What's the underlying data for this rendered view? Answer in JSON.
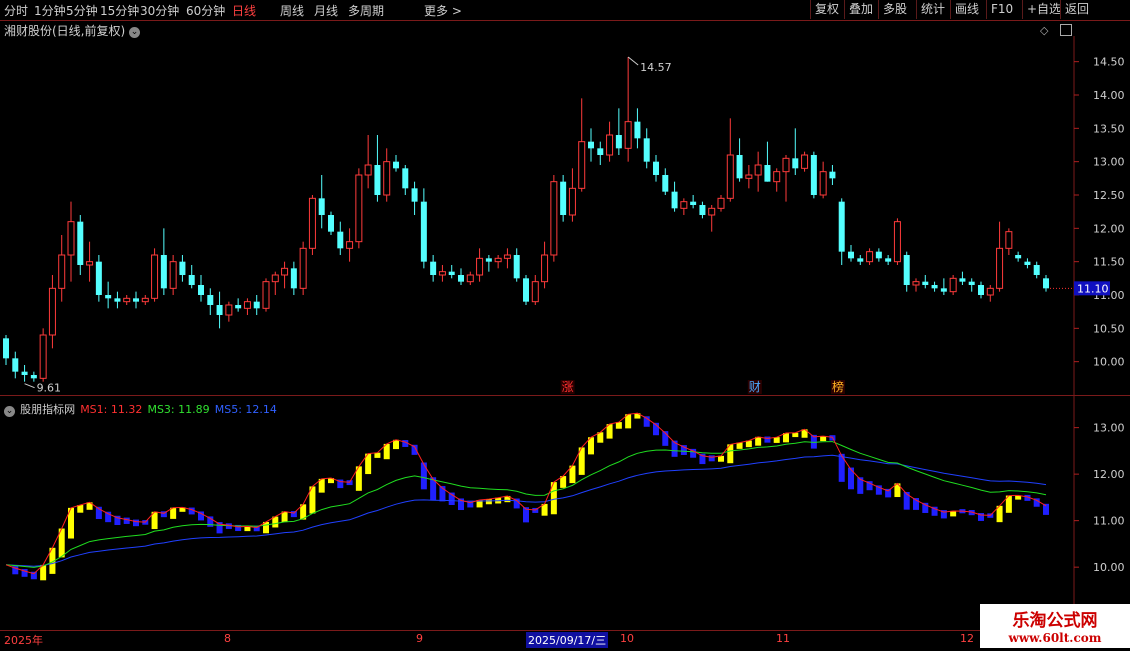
{
  "toolbar": {
    "periods": [
      "分时",
      "1分钟",
      "5分钟",
      "15分钟",
      "30分钟",
      "60分钟",
      "日线",
      "周线",
      "月线",
      "多周期",
      "更多 >"
    ],
    "active_period": "日线",
    "right_buttons": [
      "复权",
      "叠加",
      "多股",
      "统计",
      "画线",
      "F10",
      "+自选",
      "返回"
    ]
  },
  "main_chart": {
    "title": "湘财股份(日线,前复权)",
    "y_ticks": [
      "14.50",
      "14.00",
      "13.50",
      "13.00",
      "12.50",
      "12.00",
      "11.50",
      "11.00",
      "10.50",
      "10.00"
    ],
    "high_label": "14.57",
    "low_label": "9.61",
    "current_price": "11.10",
    "markers": [
      {
        "text": "涨",
        "color": "#ff3030"
      },
      {
        "text": "财",
        "color": "#4aa8ff"
      },
      {
        "text": "榜",
        "color": "#ffb020"
      }
    ]
  },
  "indicator": {
    "name": "股朋指标网",
    "ms1": "MS1: 11.32",
    "ms3": "MS3: 11.89",
    "ms5": "MS5: 12.14",
    "y_ticks": [
      "13.00",
      "12.00",
      "11.00",
      "10.00",
      "9.00"
    ]
  },
  "x_axis": {
    "labels": [
      "2025年",
      "8",
      "9",
      "2025/09/17/三",
      "10",
      "11",
      "12"
    ]
  },
  "watermark": {
    "line1": "乐淘公式网",
    "line2": "www.60lt.com"
  },
  "colors": {
    "up": "#ff3b3b",
    "down": "#54ffff",
    "ms1": "#ff2020",
    "ms3": "#20dd20",
    "ms5": "#2040ff",
    "bar_up": "#ffff00",
    "bar_down": "#2020ff"
  },
  "chart_data": {
    "type": "candlestick",
    "ohlc": [
      [
        10.35,
        10.4,
        9.95,
        10.05
      ],
      [
        10.05,
        10.15,
        9.75,
        9.85
      ],
      [
        9.85,
        9.95,
        9.7,
        9.8
      ],
      [
        9.8,
        9.85,
        9.7,
        9.75
      ],
      [
        9.75,
        10.5,
        9.7,
        10.4
      ],
      [
        10.4,
        11.3,
        10.2,
        11.1
      ],
      [
        11.1,
        11.9,
        10.9,
        11.6
      ],
      [
        11.6,
        12.4,
        11.2,
        12.1
      ],
      [
        12.1,
        12.2,
        11.3,
        11.45
      ],
      [
        11.45,
        11.8,
        11.2,
        11.5
      ],
      [
        11.5,
        11.6,
        10.9,
        11.0
      ],
      [
        11.0,
        11.2,
        10.8,
        10.95
      ],
      [
        10.95,
        11.05,
        10.8,
        10.9
      ],
      [
        10.9,
        11.0,
        10.85,
        10.95
      ],
      [
        10.95,
        11.05,
        10.8,
        10.9
      ],
      [
        10.9,
        11.0,
        10.85,
        10.95
      ],
      [
        10.95,
        11.7,
        10.9,
        11.6
      ],
      [
        11.6,
        12.0,
        11.0,
        11.1
      ],
      [
        11.1,
        11.6,
        11.0,
        11.5
      ],
      [
        11.5,
        11.6,
        11.2,
        11.3
      ],
      [
        11.3,
        11.45,
        11.1,
        11.15
      ],
      [
        11.15,
        11.3,
        10.9,
        11.0
      ],
      [
        11.0,
        11.1,
        10.7,
        10.85
      ],
      [
        10.85,
        11.05,
        10.5,
        10.7
      ],
      [
        10.7,
        10.9,
        10.6,
        10.85
      ],
      [
        10.85,
        10.95,
        10.75,
        10.8
      ],
      [
        10.8,
        10.95,
        10.7,
        10.9
      ],
      [
        10.9,
        11.0,
        10.7,
        10.8
      ],
      [
        10.8,
        11.25,
        10.75,
        11.2
      ],
      [
        11.2,
        11.35,
        11.0,
        11.3
      ],
      [
        11.3,
        11.5,
        11.1,
        11.4
      ],
      [
        11.4,
        11.5,
        11.0,
        11.1
      ],
      [
        11.1,
        11.8,
        11.0,
        11.7
      ],
      [
        11.7,
        12.5,
        11.6,
        12.45
      ],
      [
        12.45,
        12.8,
        12.0,
        12.2
      ],
      [
        12.2,
        12.25,
        11.9,
        11.95
      ],
      [
        11.95,
        12.1,
        11.6,
        11.7
      ],
      [
        11.7,
        12.0,
        11.5,
        11.8
      ],
      [
        11.8,
        12.9,
        11.7,
        12.8
      ],
      [
        12.8,
        13.4,
        12.6,
        12.95
      ],
      [
        12.95,
        13.4,
        12.4,
        12.5
      ],
      [
        12.5,
        13.2,
        12.4,
        13.0
      ],
      [
        13.0,
        13.1,
        12.85,
        12.9
      ],
      [
        12.9,
        12.95,
        12.5,
        12.6
      ],
      [
        12.6,
        12.7,
        12.2,
        12.4
      ],
      [
        12.4,
        12.6,
        11.4,
        11.5
      ],
      [
        11.5,
        11.6,
        11.2,
        11.3
      ],
      [
        11.3,
        11.45,
        11.2,
        11.35
      ],
      [
        11.35,
        11.45,
        11.25,
        11.3
      ],
      [
        11.3,
        11.4,
        11.15,
        11.2
      ],
      [
        11.2,
        11.35,
        11.15,
        11.3
      ],
      [
        11.3,
        11.7,
        11.2,
        11.55
      ],
      [
        11.55,
        11.6,
        11.35,
        11.5
      ],
      [
        11.5,
        11.6,
        11.4,
        11.55
      ],
      [
        11.55,
        11.7,
        11.4,
        11.6
      ],
      [
        11.6,
        11.7,
        11.2,
        11.25
      ],
      [
        11.25,
        11.3,
        10.85,
        10.9
      ],
      [
        10.9,
        11.3,
        10.85,
        11.2
      ],
      [
        11.2,
        11.8,
        11.1,
        11.6
      ],
      [
        11.6,
        12.8,
        11.5,
        12.7
      ],
      [
        12.7,
        12.8,
        12.1,
        12.2
      ],
      [
        12.2,
        12.9,
        12.1,
        12.6
      ],
      [
        12.6,
        13.95,
        12.55,
        13.3
      ],
      [
        13.3,
        13.5,
        13.0,
        13.2
      ],
      [
        13.2,
        13.3,
        12.95,
        13.1
      ],
      [
        13.1,
        13.6,
        13.0,
        13.4
      ],
      [
        13.4,
        13.8,
        13.1,
        13.2
      ],
      [
        13.2,
        14.57,
        13.0,
        13.6
      ],
      [
        13.6,
        13.8,
        13.2,
        13.35
      ],
      [
        13.35,
        13.5,
        12.9,
        13.0
      ],
      [
        13.0,
        13.1,
        12.7,
        12.8
      ],
      [
        12.8,
        12.9,
        12.5,
        12.55
      ],
      [
        12.55,
        12.7,
        12.25,
        12.3
      ],
      [
        12.3,
        12.45,
        12.2,
        12.4
      ],
      [
        12.4,
        12.5,
        12.3,
        12.35
      ],
      [
        12.35,
        12.4,
        12.15,
        12.2
      ],
      [
        12.2,
        12.35,
        11.95,
        12.3
      ],
      [
        12.3,
        12.5,
        12.25,
        12.45
      ],
      [
        12.45,
        13.65,
        12.4,
        13.1
      ],
      [
        13.1,
        13.35,
        12.7,
        12.75
      ],
      [
        12.75,
        12.95,
        12.6,
        12.8
      ],
      [
        12.8,
        13.15,
        12.55,
        12.95
      ],
      [
        12.95,
        13.3,
        12.7,
        12.7
      ],
      [
        12.7,
        12.9,
        12.55,
        12.85
      ],
      [
        12.85,
        13.1,
        12.4,
        13.05
      ],
      [
        13.05,
        13.5,
        12.8,
        12.9
      ],
      [
        12.9,
        13.15,
        12.85,
        13.1
      ],
      [
        13.1,
        13.15,
        12.45,
        12.5
      ],
      [
        12.5,
        13.0,
        12.45,
        12.85
      ],
      [
        12.85,
        12.95,
        12.65,
        12.75
      ],
      [
        12.4,
        12.45,
        11.45,
        11.65
      ],
      [
        11.65,
        11.75,
        11.5,
        11.55
      ],
      [
        11.55,
        11.6,
        11.45,
        11.5
      ],
      [
        11.5,
        11.7,
        11.45,
        11.65
      ],
      [
        11.65,
        11.7,
        11.5,
        11.55
      ],
      [
        11.55,
        11.6,
        11.45,
        11.5
      ],
      [
        11.5,
        12.15,
        11.45,
        12.1
      ],
      [
        11.6,
        11.65,
        11.05,
        11.15
      ],
      [
        11.15,
        11.25,
        11.05,
        11.2
      ],
      [
        11.2,
        11.3,
        11.1,
        11.15
      ],
      [
        11.15,
        11.2,
        11.05,
        11.1
      ],
      [
        11.1,
        11.25,
        11.0,
        11.05
      ],
      [
        11.05,
        11.3,
        11.0,
        11.25
      ],
      [
        11.25,
        11.35,
        11.15,
        11.2
      ],
      [
        11.2,
        11.25,
        11.05,
        11.15
      ],
      [
        11.15,
        11.2,
        10.95,
        11.0
      ],
      [
        11.0,
        11.15,
        10.9,
        11.1
      ],
      [
        11.1,
        12.1,
        11.05,
        11.7
      ],
      [
        11.7,
        12.0,
        11.6,
        11.95
      ],
      [
        11.6,
        11.65,
        11.5,
        11.55
      ],
      [
        11.5,
        11.55,
        11.4,
        11.45
      ],
      [
        11.45,
        11.5,
        11.25,
        11.3
      ],
      [
        11.25,
        11.3,
        11.05,
        11.1
      ]
    ],
    "ylim": [
      9.5,
      14.75
    ],
    "indicator_ylim": [
      8.95,
      13.25
    ]
  }
}
